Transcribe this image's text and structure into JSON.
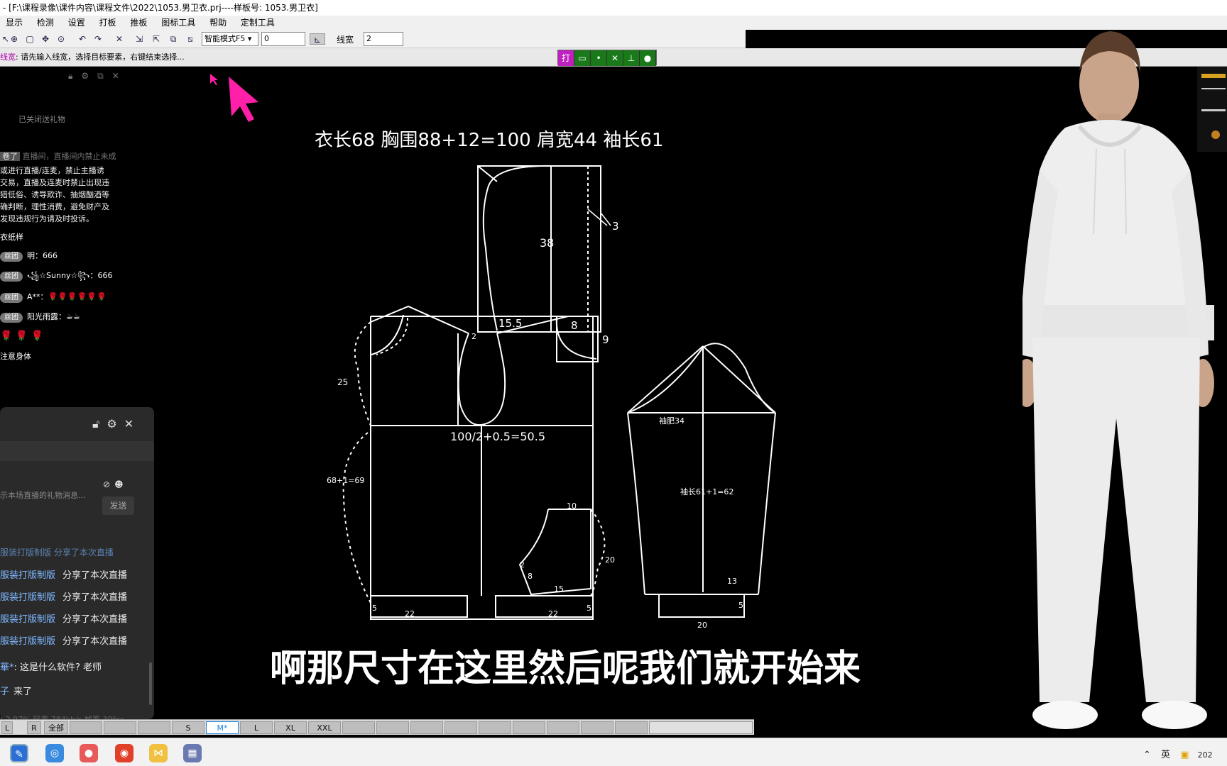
{
  "window": {
    "title": "- [F:\\课程录像\\课件内容\\课程文件\\2022\\1053.男卫衣.prj----样板号: 1053.男卫衣]"
  },
  "menu": [
    "显示",
    "检测",
    "设置",
    "打板",
    "推板",
    "图标工具",
    "帮助",
    "定制工具"
  ],
  "toolbar": {
    "mode_select": "智能模式F5",
    "value_field": "0",
    "linewidth_label": "线宽",
    "linewidth_value": "2"
  },
  "status": {
    "prompt_prefix": "线宽",
    "prompt": ": 请先输入线宽，选择目标要素，右键结束选择...",
    "snap_first": "打"
  },
  "live_panel": {
    "gift_closed": "已关闭送礼物",
    "notice_faded": "直播间，直播间内禁止未成",
    "notice_badge": "卷了",
    "notice_lines": [
      "或进行直播/连麦，禁止主播诱",
      "交易，直播及连麦时禁止出现违",
      "猎低俗、诱导欺诈、抽烟酗酒等",
      "确判断，理性消费，避免财产及",
      "发现违规行为请及时投诉。"
    ],
    "chat": [
      {
        "badge": "",
        "text": "衣纸样"
      },
      {
        "badge": "丝团",
        "text": "明：666"
      },
      {
        "badge": "丝团",
        "text": "꧁☆Sunny☆꧂：666"
      },
      {
        "badge": "丝团",
        "text": "A**：🌹🌹🌹🌹🌹🌹"
      },
      {
        "badge": "丝团",
        "text": "阳光雨露：☕☕"
      },
      {
        "badge": "",
        "text": "🌹 🌹 🌹"
      },
      {
        "badge": "",
        "text": "注意身体"
      }
    ]
  },
  "gift_panel": {
    "input_placeholder": "示本场直播的礼物消息...",
    "send": "发送",
    "top_share": "服装打版制版  分享了本次直播",
    "shares": [
      {
        "name": "服装打版制版",
        "action": "分享了本次直播"
      },
      {
        "name": "服装打版制版",
        "action": "分享了本次直播"
      },
      {
        "name": "服装打版制版",
        "action": "分享了本次直播"
      },
      {
        "name": "服装打版制版",
        "action": "分享了本次直播"
      }
    ],
    "question_name": "華*",
    "question_text": ": 这是什么软件? 老师",
    "join_name": "子",
    "join_text": "来了",
    "stats": "t 2.07%    码率 784kb/s    帧率 30fps"
  },
  "pattern": {
    "header": "衣长68   胸围88+12=100   肩宽44   袖长61",
    "labels": {
      "hood_width": "38",
      "hood_offset": "3",
      "neck_width": "15.5",
      "neck_depth": "8",
      "hood_neck_drop": "9",
      "shoulder_drop": "2",
      "armhole": "25",
      "chest": "100/2+0.5=50.5",
      "length": "68+1=69",
      "pocket_top": "10",
      "pocket_side": "20",
      "pocket_angle": "2",
      "pocket_inner": "8",
      "pocket_bottom": "15",
      "hem_front": "22",
      "hem_back": "22",
      "hem_left": "5",
      "hem_right": "5",
      "sleeve_bicep": "袖肥34",
      "sleeve_length": "袖长61+1=62",
      "cuff": "13",
      "cuff_rib": "5",
      "cuff_width": "20"
    }
  },
  "subtitle": "啊那尺寸在这里然后呢我们就开始来",
  "sizes": {
    "left": [
      "L",
      "R",
      "全部"
    ],
    "labels": [
      "S",
      "M*",
      "L",
      "XL",
      "XXL"
    ],
    "active": "M*"
  },
  "taskbar": {
    "tray": "英",
    "year": "202"
  },
  "colors": {
    "cursor": "#ff1fa8",
    "snap_bg": "#1a7a1a",
    "snap_first_bg": "#c020c0",
    "link": "#7db7ff"
  }
}
